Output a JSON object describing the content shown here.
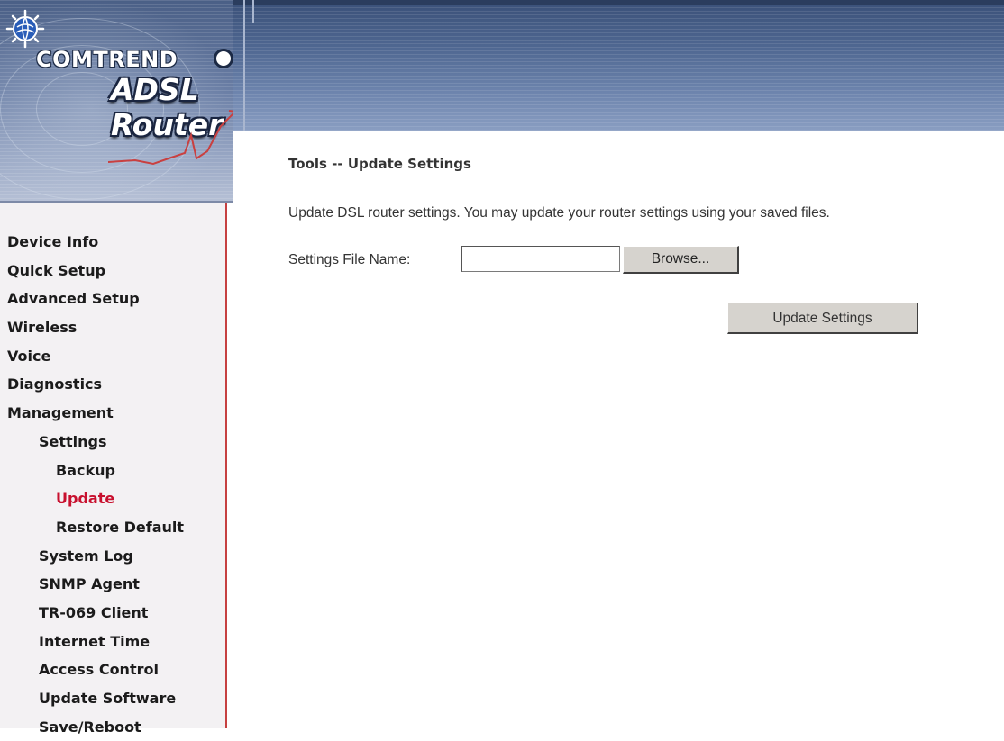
{
  "header": {
    "brand": "COMTREND",
    "product": "ADSL Router"
  },
  "colors": {
    "active_nav": "#c8102e",
    "sidebar_border": "#c64040",
    "header_blue": "#4e6690"
  },
  "sidebar": {
    "items": [
      {
        "label": "Device Info",
        "level": 0,
        "active": false
      },
      {
        "label": "Quick Setup",
        "level": 0,
        "active": false
      },
      {
        "label": "Advanced Setup",
        "level": 0,
        "active": false
      },
      {
        "label": "Wireless",
        "level": 0,
        "active": false
      },
      {
        "label": "Voice",
        "level": 0,
        "active": false
      },
      {
        "label": "Diagnostics",
        "level": 0,
        "active": false
      },
      {
        "label": "Management",
        "level": 0,
        "active": false
      },
      {
        "label": "Settings",
        "level": 1,
        "active": false
      },
      {
        "label": "Backup",
        "level": 2,
        "active": false
      },
      {
        "label": "Update",
        "level": 2,
        "active": true
      },
      {
        "label": "Restore Default",
        "level": 2,
        "active": false
      },
      {
        "label": "System Log",
        "level": 1,
        "active": false
      },
      {
        "label": "SNMP Agent",
        "level": 1,
        "active": false
      },
      {
        "label": "TR-069 Client",
        "level": 1,
        "active": false
      },
      {
        "label": "Internet Time",
        "level": 1,
        "active": false
      },
      {
        "label": "Access Control",
        "level": 1,
        "active": false
      },
      {
        "label": "Update Software",
        "level": 1,
        "active": false
      },
      {
        "label": "Save/Reboot",
        "level": 1,
        "active": false
      }
    ]
  },
  "main": {
    "title": "Tools -- Update Settings",
    "description": "Update DSL router settings. You may update your router settings using your saved files.",
    "file_label": "Settings File Name:",
    "file_value": "",
    "browse_label": "Browse...",
    "update_label": "Update Settings"
  }
}
